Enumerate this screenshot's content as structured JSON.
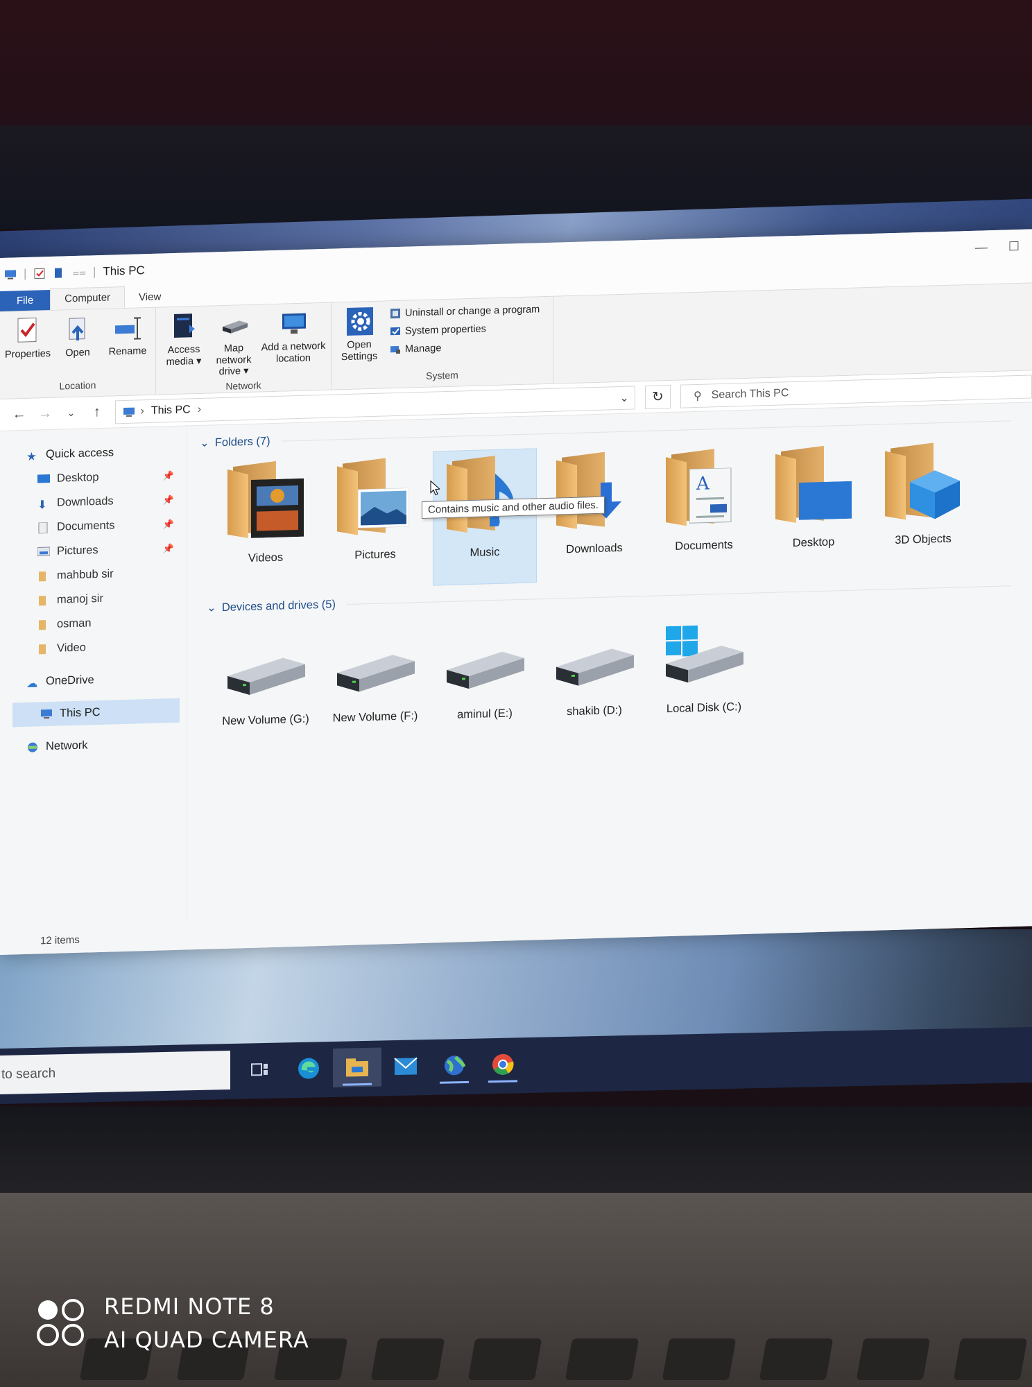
{
  "window": {
    "title": "This PC",
    "tabs": [
      {
        "label": "File"
      },
      {
        "label": "Computer"
      },
      {
        "label": "View"
      }
    ]
  },
  "ribbon": {
    "location": {
      "label": "Location",
      "buttons": [
        {
          "label": "Properties",
          "icon": "checkmark-properties-icon"
        },
        {
          "label": "Open",
          "icon": "open-icon"
        },
        {
          "label": "Rename",
          "icon": "rename-icon"
        }
      ]
    },
    "network": {
      "label": "Network",
      "buttons": [
        {
          "label": "Access media ▾",
          "icon": "media-server-icon"
        },
        {
          "label": "Map network drive ▾",
          "icon": "network-drive-icon"
        },
        {
          "label": "Add a network location",
          "icon": "network-location-icon"
        }
      ]
    },
    "system": {
      "label": "System",
      "open_settings": "Open Settings",
      "items": [
        {
          "label": "Uninstall or change a program"
        },
        {
          "label": "System properties"
        },
        {
          "label": "Manage"
        }
      ]
    }
  },
  "address": {
    "path": "This PC",
    "search_placeholder": "Search This PC"
  },
  "sidebar": {
    "quick_access": "Quick access",
    "pinned": [
      {
        "label": "Desktop"
      },
      {
        "label": "Downloads"
      },
      {
        "label": "Documents"
      },
      {
        "label": "Pictures"
      }
    ],
    "folders": [
      {
        "label": "mahbub sir"
      },
      {
        "label": "manoj sir"
      },
      {
        "label": "osman"
      },
      {
        "label": "Video"
      }
    ],
    "onedrive": "OneDrive",
    "this_pc": "This PC",
    "network": "Network"
  },
  "main": {
    "folders_header": "Folders (7)",
    "folders": [
      {
        "label": "Videos",
        "icon": "videos-folder-icon"
      },
      {
        "label": "Pictures",
        "icon": "pictures-folder-icon"
      },
      {
        "label": "Music",
        "icon": "music-folder-icon"
      },
      {
        "label": "Downloads",
        "icon": "downloads-folder-icon"
      },
      {
        "label": "Documents",
        "icon": "documents-folder-icon"
      },
      {
        "label": "Desktop",
        "icon": "desktop-folder-icon"
      },
      {
        "label": "3D Objects",
        "icon": "3d-objects-folder-icon"
      }
    ],
    "tooltip": "Contains music and other audio files.",
    "drives_header": "Devices and drives (5)",
    "drives": [
      {
        "label": "New Volume (G:)"
      },
      {
        "label": "New Volume (F:)"
      },
      {
        "label": "aminul (E:)"
      },
      {
        "label": "shakib (D:)"
      },
      {
        "label": "Local Disk (C:)"
      }
    ]
  },
  "status": {
    "items": "12 items"
  },
  "taskbar": {
    "search_text": "to search"
  },
  "watermark": {
    "line1": "REDMI NOTE 8",
    "line2": "AI QUAD CAMERA"
  },
  "colors": {
    "accent": "#2b63b8",
    "selection": "#cde0f5",
    "taskbar": "#1d2744"
  }
}
